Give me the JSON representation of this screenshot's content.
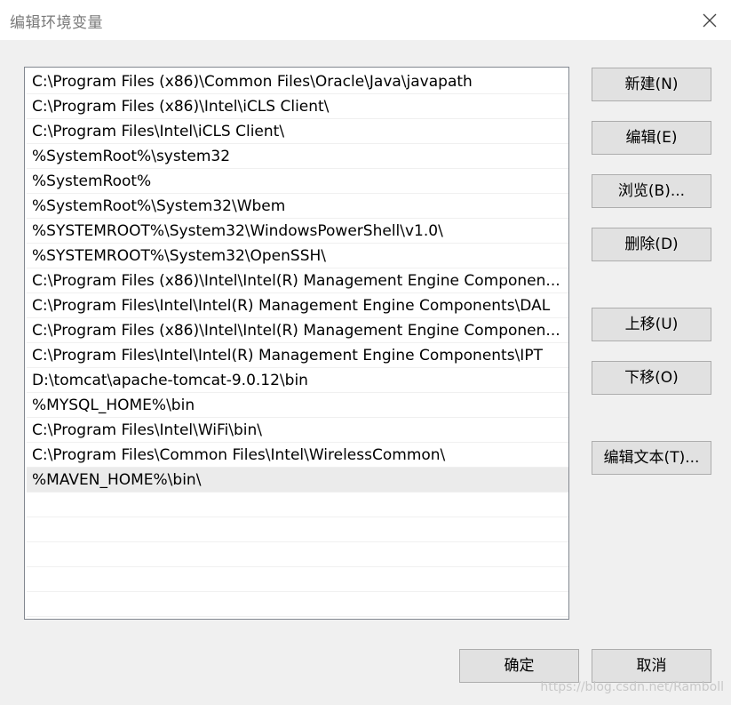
{
  "window": {
    "title": "编辑环境变量"
  },
  "list": {
    "items": [
      "C:\\Program Files (x86)\\Common Files\\Oracle\\Java\\javapath",
      "C:\\Program Files (x86)\\Intel\\iCLS Client\\",
      "C:\\Program Files\\Intel\\iCLS Client\\",
      "%SystemRoot%\\system32",
      "%SystemRoot%",
      "%SystemRoot%\\System32\\Wbem",
      "%SYSTEMROOT%\\System32\\WindowsPowerShell\\v1.0\\",
      "%SYSTEMROOT%\\System32\\OpenSSH\\",
      "C:\\Program Files (x86)\\Intel\\Intel(R) Management Engine Componen...",
      "C:\\Program Files\\Intel\\Intel(R) Management Engine Components\\DAL",
      "C:\\Program Files (x86)\\Intel\\Intel(R) Management Engine Componen...",
      "C:\\Program Files\\Intel\\Intel(R) Management Engine Components\\IPT",
      "D:\\tomcat\\apache-tomcat-9.0.12\\bin",
      "%MYSQL_HOME%\\bin",
      "C:\\Program Files\\Intel\\WiFi\\bin\\",
      "C:\\Program Files\\Common Files\\Intel\\WirelessCommon\\",
      "%MAVEN_HOME%\\bin\\"
    ],
    "selected_index": 16
  },
  "buttons": {
    "new": "新建(N)",
    "edit": "编辑(E)",
    "browse": "浏览(B)...",
    "delete": "删除(D)",
    "move_up": "上移(U)",
    "move_down": "下移(O)",
    "edit_text": "编辑文本(T)...",
    "ok": "确定",
    "cancel": "取消"
  },
  "watermark": "https://blog.csdn.net/Ramboll"
}
